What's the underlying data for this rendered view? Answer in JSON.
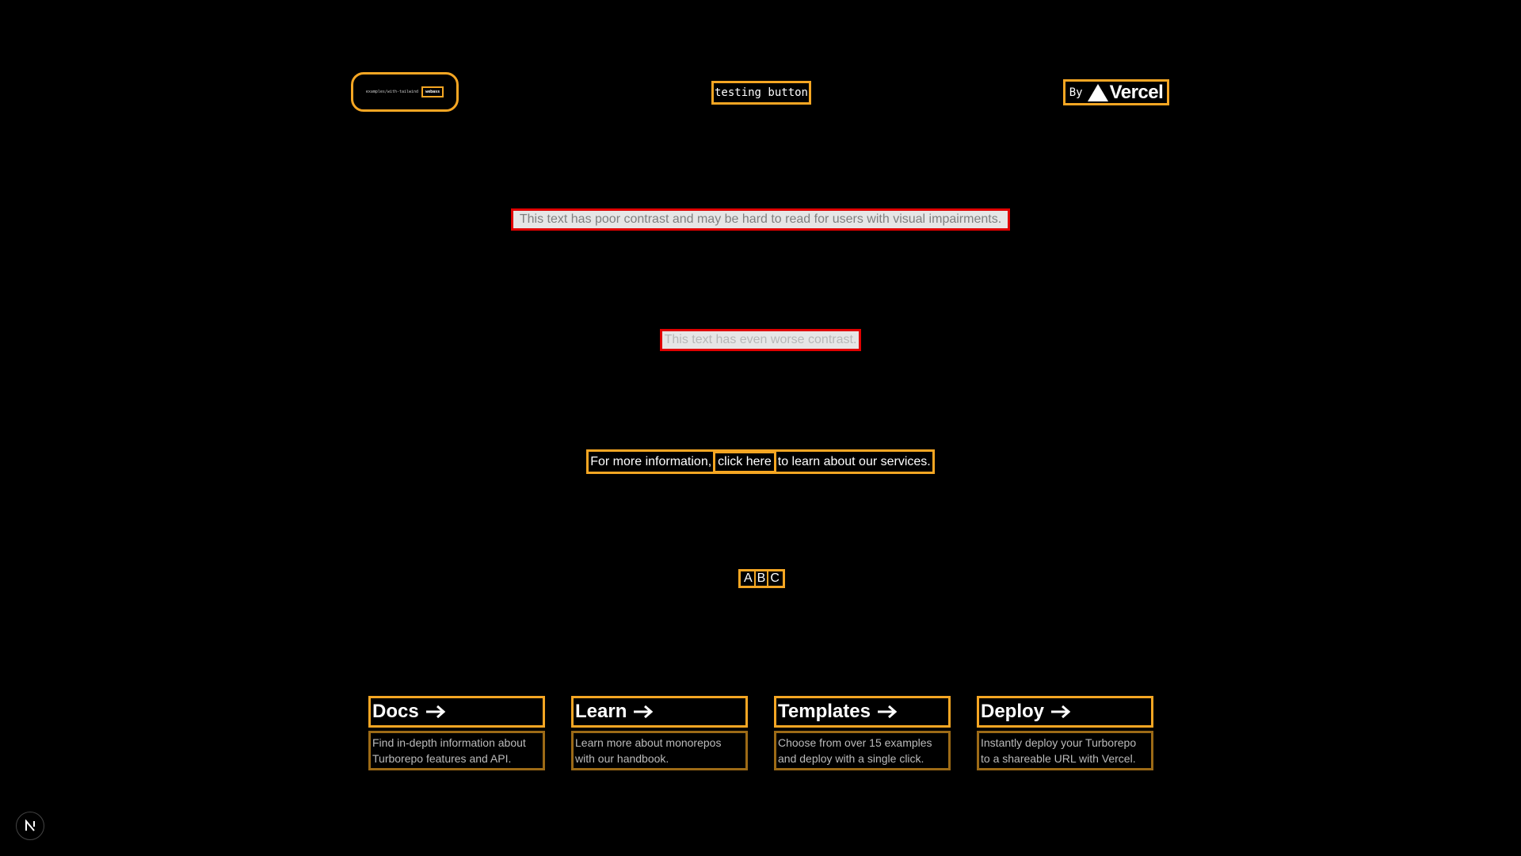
{
  "header": {
    "pill_text": "examples/with-tailwind",
    "pill_code": "webass",
    "testing_button_label": "testing button",
    "by_label": "By",
    "vercel_label": "Vercel"
  },
  "contrast": {
    "poor_text": "This text has poor contrast and may be hard to read for users with visual impairments.",
    "worse_text": "This text has even worse contrast."
  },
  "info": {
    "before": "For more information,",
    "link": "click here",
    "after": "to learn about our services."
  },
  "abc": [
    "A",
    "B",
    "C"
  ],
  "cards": [
    {
      "title": "Docs",
      "desc_line1": "Find in-depth information about",
      "desc_line2": "Turborepo features and API."
    },
    {
      "title": "Learn",
      "desc_line1": "Learn more about monorepos",
      "desc_line2": "with our handbook."
    },
    {
      "title": "Templates",
      "desc_line1": "Choose from over 15 examples",
      "desc_line2": "and deploy with a single click."
    },
    {
      "title": "Deploy",
      "desc_line1": "Instantly deploy your Turborepo",
      "desc_line2": "to a shareable URL with Vercel."
    }
  ],
  "badge": {
    "letter": "N"
  },
  "colors": {
    "highlight": "#f5a623",
    "error": "#e00000",
    "background": "#000000"
  },
  "icons": {
    "card_arrow": "arrow-right-icon",
    "vercel": "vercel-triangle-icon",
    "badge": "nextjs-icon"
  }
}
